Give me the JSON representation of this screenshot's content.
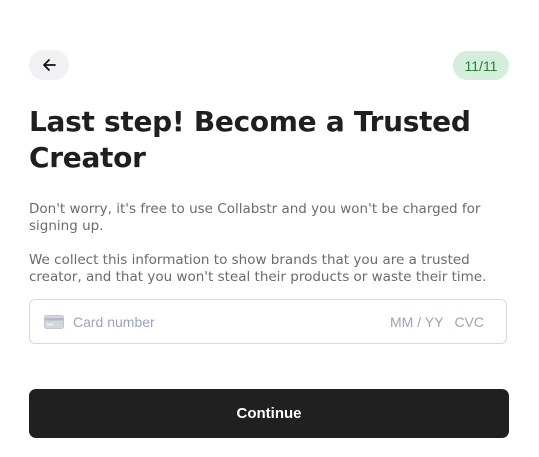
{
  "header": {
    "back_icon": "arrow-left-icon",
    "step_indicator": "11/11"
  },
  "main": {
    "title": "Last step! Become a Trusted Creator",
    "paragraphs": [
      "Don't worry, it's free to use Collabstr and you won't be charged for signing up.",
      "We collect this information to show brands that you are a trusted creator, and that you won't steal their products or waste their time."
    ]
  },
  "card_input": {
    "icon": "credit-card-icon",
    "number_placeholder": "Card number",
    "expiry_placeholder": "MM / YY",
    "cvc_placeholder": "CVC"
  },
  "actions": {
    "continue_label": "Continue"
  },
  "colors": {
    "badge_bg": "#d5eedc",
    "badge_text": "#22803a",
    "button_bg": "#202020"
  }
}
